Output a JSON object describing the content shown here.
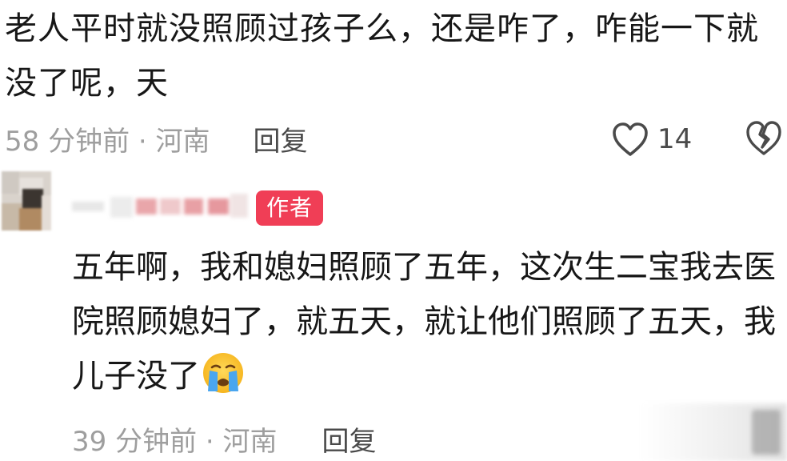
{
  "comment1": {
    "text": "老人平时就没照顾过孩子么，还是咋了，咋能一下就没了呢，天",
    "time_location": "58 分钟前 · 河南",
    "reply_label": "回复",
    "like_count": "14",
    "like_icon": "heart-outline-icon",
    "dislike_icon": "broken-heart-icon"
  },
  "comment2": {
    "avatar": "avatar-blurred",
    "username_blurred": true,
    "badge": "作者",
    "badge_color": "#f03e56",
    "text": "五年啊，我和媳妇照顾了五年，这次生二宝我去医院照顾媳妇了，就五天，就让他们照顾了五天，我儿子没了",
    "emoji": "crying-face-emoji",
    "time_location": "39 分钟前 · 河南",
    "reply_label": "回复"
  }
}
